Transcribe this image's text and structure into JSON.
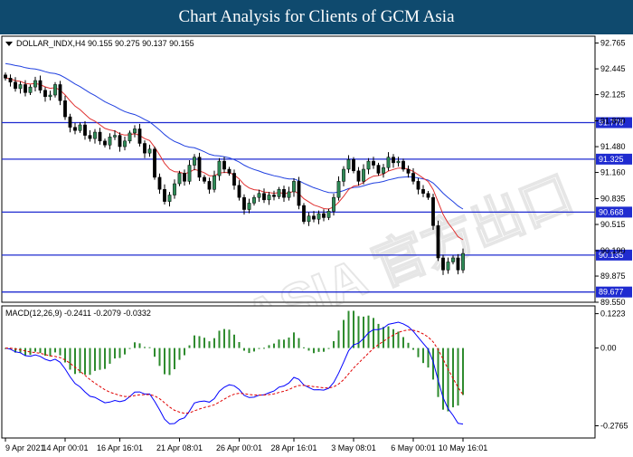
{
  "banner": {
    "title": "Chart Analysis for Clients of GCM Asia"
  },
  "chart_data": [
    {
      "type": "candlestick",
      "symbol_header": "DOLLAR_INDX,H4  90.155 90.275 90.137 90.155",
      "ohlc_header": {
        "open": 90.155,
        "high": 90.275,
        "low": 90.137,
        "close": 90.155
      },
      "ylim": [
        89.55,
        92.85
      ],
      "y_ticks": [
        "92.765",
        "92.445",
        "92.125",
        "91.800",
        "91.480",
        "91.160",
        "90.835",
        "90.515",
        "90.190",
        "89.875",
        "89.550"
      ],
      "x_ticks": [
        "9 Apr 2021",
        "14 Apr 00:01",
        "16 Apr 16:01",
        "21 Apr 08:01",
        "26 Apr 00:01",
        "28 Apr 16:01",
        "3 May 08:01",
        "6 May 00:01",
        "10 May 16:01"
      ],
      "horizontal_levels": [
        {
          "value": 91.778,
          "label": "91.778"
        },
        {
          "value": 91.325,
          "label": "91.325"
        },
        {
          "value": 90.668,
          "label": "90.668"
        },
        {
          "value": 90.135,
          "label": "90.135"
        },
        {
          "value": 89.677,
          "label": "89.677"
        }
      ],
      "close": [
        92.33,
        92.28,
        92.2,
        92.25,
        92.15,
        92.22,
        92.3,
        92.18,
        92.1,
        92.12,
        92.25,
        92.05,
        91.85,
        91.72,
        91.68,
        91.75,
        91.62,
        91.58,
        91.66,
        91.55,
        91.5,
        91.6,
        91.62,
        91.48,
        91.55,
        91.65,
        91.7,
        91.52,
        91.4,
        91.45,
        91.1,
        90.95,
        90.8,
        90.88,
        91.02,
        91.15,
        91.05,
        91.25,
        91.35,
        91.1,
        91.05,
        90.95,
        91.12,
        91.3,
        91.2,
        91.15,
        91.0,
        90.85,
        90.7,
        90.78,
        90.85,
        90.9,
        90.82,
        90.88,
        90.86,
        90.95,
        90.85,
        90.92,
        91.05,
        90.75,
        90.55,
        90.62,
        90.58,
        90.65,
        90.6,
        90.68,
        90.85,
        91.05,
        91.2,
        91.32,
        91.18,
        91.05,
        91.2,
        91.3,
        91.25,
        91.15,
        91.22,
        91.35,
        91.28,
        91.3,
        91.2,
        91.15,
        91.05,
        90.95,
        90.9,
        90.85,
        90.5,
        90.1,
        89.95,
        90.05,
        90.1,
        89.95,
        90.155
      ],
      "series": [
        {
          "name": "",
          "color": "#e03030"
        },
        {
          "name": "",
          "color": "#2040e0"
        }
      ]
    },
    {
      "type": "histogram+line",
      "indicator_header": "MACD(12,26,9) -0.2411 -0.2079 -0.0332",
      "values": {
        "main": -0.2411,
        "signal": -0.2079,
        "histogram": -0.0332
      },
      "ylim": [
        -0.32,
        0.15
      ],
      "y_ticks": [
        "0.1223",
        "0.00",
        "-0.2765"
      ],
      "series": [
        {
          "name": "",
          "color": "#0000ff"
        },
        {
          "name": "",
          "color": "#e00000"
        },
        {
          "name": "",
          "color": "#2e8b2e"
        }
      ]
    }
  ],
  "colors": {
    "bull_candle": "#2e8b57",
    "bear_candle": "#000000",
    "level_line": "#1f2bd0",
    "accent": "#0f4a6e"
  }
}
